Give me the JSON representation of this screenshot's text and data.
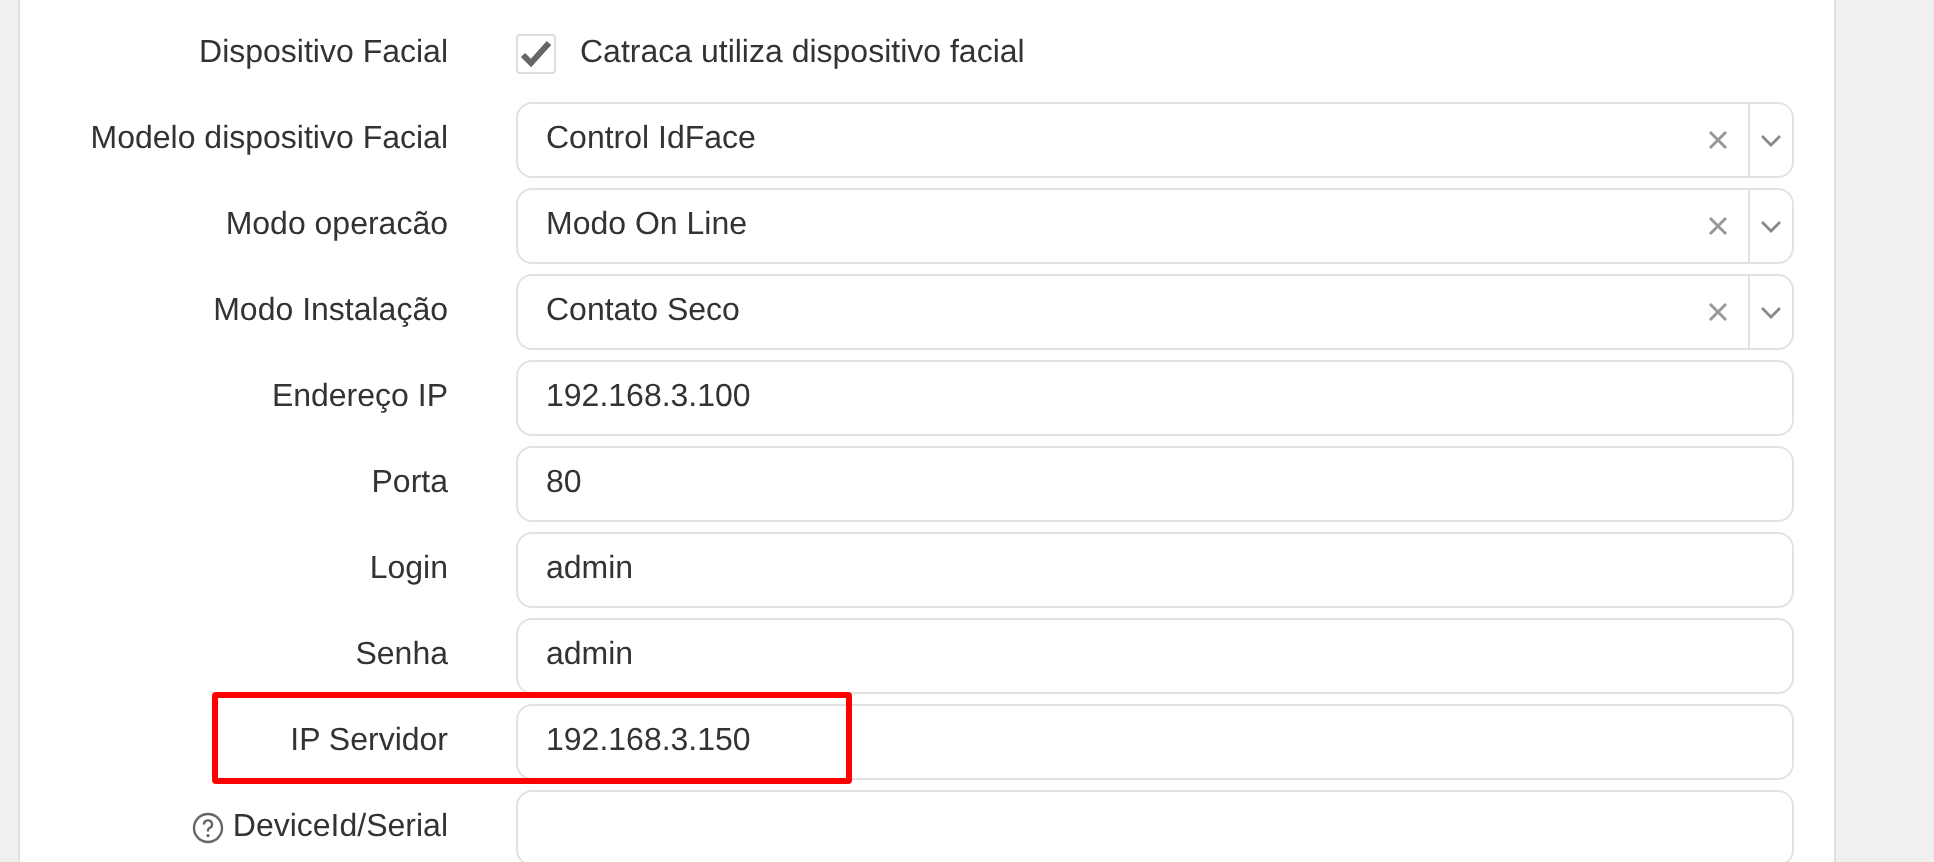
{
  "form": {
    "rows": [
      {
        "kind": "checkbox",
        "label": "Dispositivo Facial",
        "option": "Catraca utiliza dispositivo facial",
        "checked": true,
        "highlighted": false
      },
      {
        "kind": "select",
        "label": "Modelo dispositivo Facial",
        "value": "Control IdFace",
        "highlighted": false
      },
      {
        "kind": "select",
        "label": "Modo operacão",
        "value": "Modo On Line",
        "highlighted": false
      },
      {
        "kind": "select",
        "label": "Modo Instalação",
        "value": "Contato Seco",
        "highlighted": false
      },
      {
        "kind": "input",
        "label": "Endereço IP",
        "value": "192.168.3.100",
        "highlighted": false
      },
      {
        "kind": "input",
        "label": "Porta",
        "value": "80",
        "highlighted": false
      },
      {
        "kind": "input",
        "label": "Login",
        "value": "admin",
        "highlighted": false
      },
      {
        "kind": "input",
        "label": "Senha",
        "value": "admin",
        "highlighted": false
      },
      {
        "kind": "input",
        "label": "IP Servidor",
        "value": "192.168.3.150",
        "highlighted": true
      },
      {
        "kind": "input",
        "label": "DeviceId/Serial",
        "help": true,
        "value": "",
        "highlighted": false
      }
    ]
  }
}
